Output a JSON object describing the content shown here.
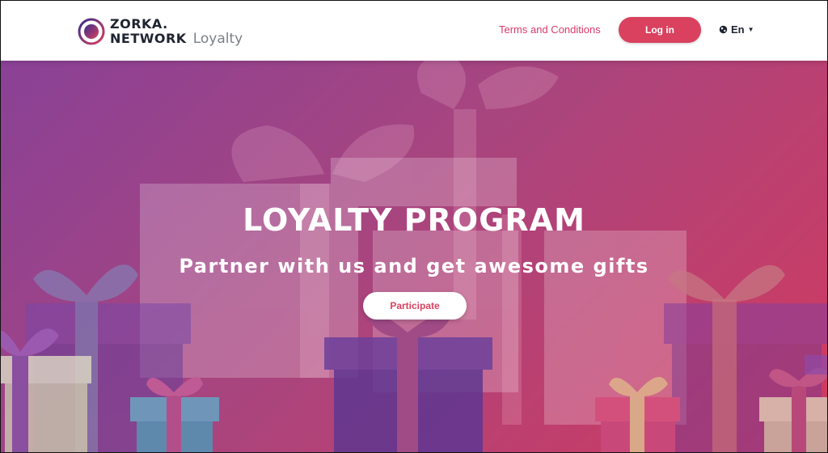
{
  "header": {
    "logo": {
      "line1": "ZORKA.",
      "line2": "NETWORK",
      "product": "Loyalty",
      "icon": "zorka-logo-icon"
    },
    "terms_label": "Terms and Conditions",
    "login_label": "Log in",
    "language": {
      "selected": "En",
      "icon": "globe-icon"
    }
  },
  "hero": {
    "title": "LOYALTY PROGRAM",
    "subtitle": "Partner with us and get awesome gifts",
    "cta_label": "Participate"
  },
  "colors": {
    "accent": "#d9415f",
    "link": "#d93a6b",
    "hero_gradient_start": "#8a4196",
    "hero_gradient_end": "#d13a5f",
    "text_dark": "#1e2430"
  }
}
